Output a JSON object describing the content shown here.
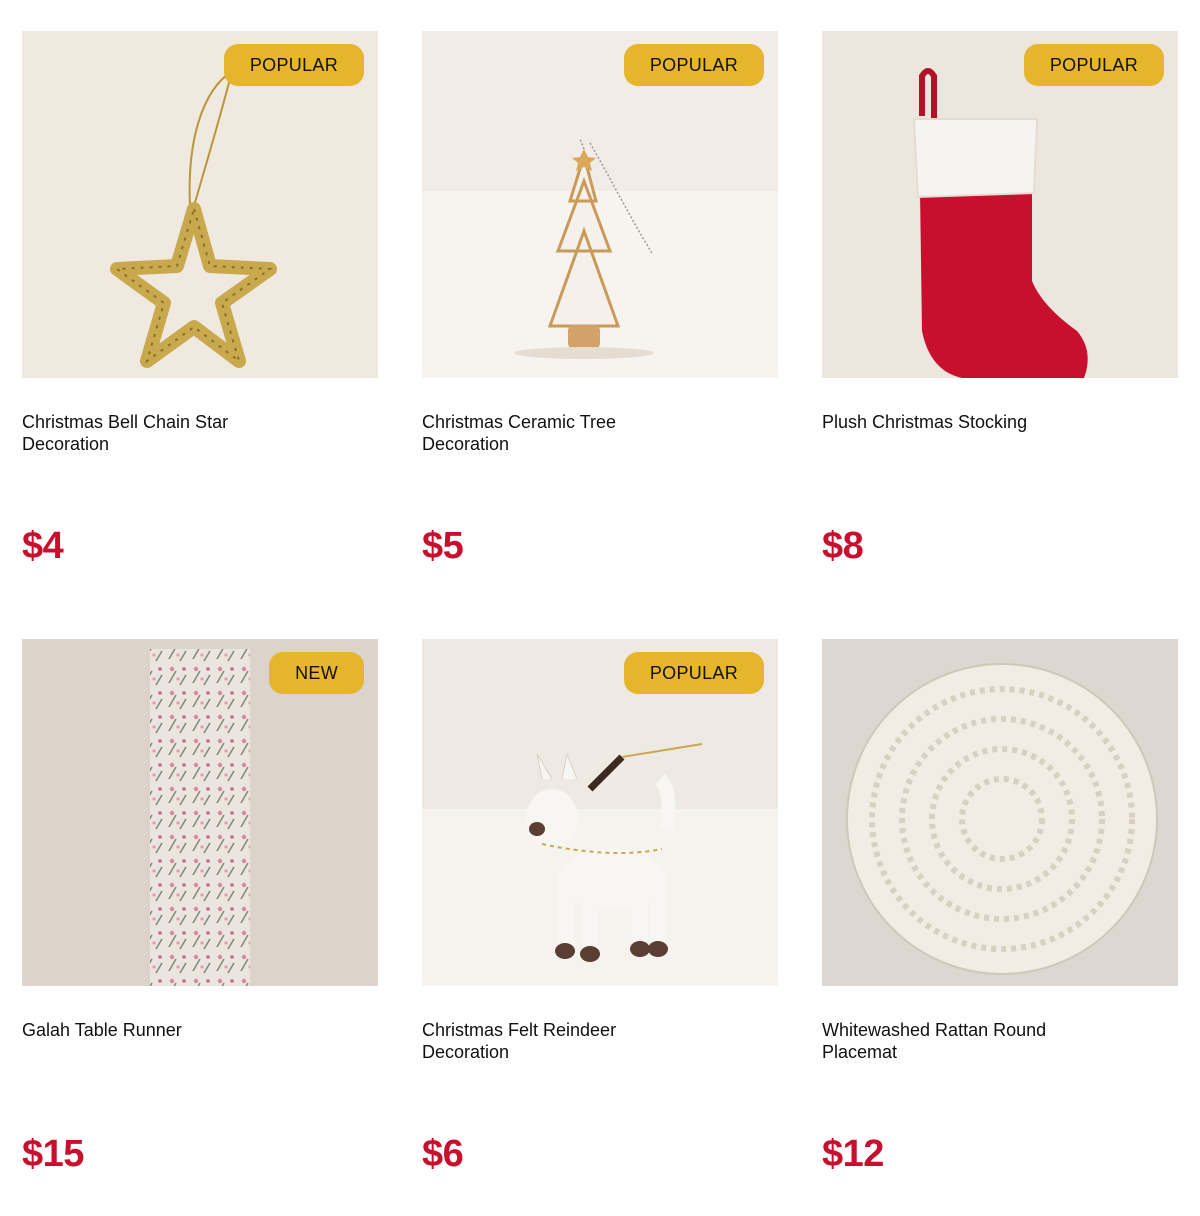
{
  "colors": {
    "badge": "#e5b62b",
    "price": "#c8102e"
  },
  "products": [
    {
      "name": "Christmas Bell Chain Star Decoration",
      "price": "$4",
      "badge": "POPULAR",
      "icon": "star-ornament-image"
    },
    {
      "name": "Christmas Ceramic Tree Decoration",
      "price": "$5",
      "badge": "POPULAR",
      "icon": "ceramic-tree-image"
    },
    {
      "name": "Plush Christmas Stocking",
      "price": "$8",
      "badge": "POPULAR",
      "icon": "stocking-image"
    },
    {
      "name": "Galah Table Runner",
      "price": "$15",
      "badge": "NEW",
      "icon": "table-runner-image"
    },
    {
      "name": "Christmas Felt Reindeer Decoration",
      "price": "$6",
      "badge": "POPULAR",
      "icon": "reindeer-image"
    },
    {
      "name": "Whitewashed Rattan Round Placemat",
      "price": "$12",
      "badge": "",
      "icon": "placemat-image"
    }
  ]
}
